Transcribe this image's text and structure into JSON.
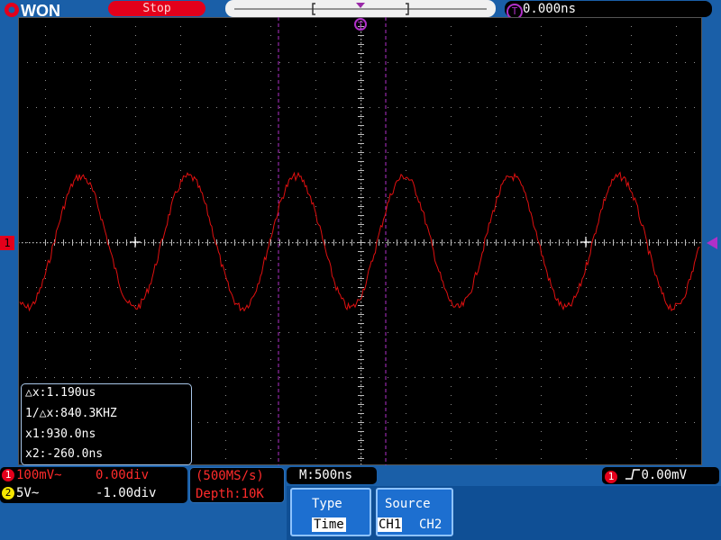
{
  "header": {
    "brand": "OWON",
    "run_state": "Stop",
    "trigger_marker": "T",
    "trigger_position": "0.000ns"
  },
  "measurements": {
    "delta_x": "△x:1.190us",
    "inv_delta_x": "1/△x:840.3KHZ",
    "x1": "x1:930.0ns",
    "x2": "x2:-260.0ns"
  },
  "channels": [
    {
      "number": "1",
      "scale": "100mV~",
      "offset": "0.00div",
      "color": "#e3001b"
    },
    {
      "number": "2",
      "scale": "5V~",
      "offset": "-1.00div",
      "color": "#f5e600"
    }
  ],
  "acquisition": {
    "sample_rate": "(500MS/s)",
    "depth": "Depth:10K"
  },
  "timebase": "M:500ns",
  "trigger": {
    "channel": "1",
    "level": "0.00mV"
  },
  "menu": {
    "type_label": "Type",
    "type_value": "Time",
    "source_label": "Source",
    "source_options": [
      "CH1",
      "CH2"
    ]
  },
  "colors": {
    "trace": "#e01010",
    "cursor": "#b030c8",
    "panel": "#1a5fa8",
    "accent": "#e3001b"
  }
}
